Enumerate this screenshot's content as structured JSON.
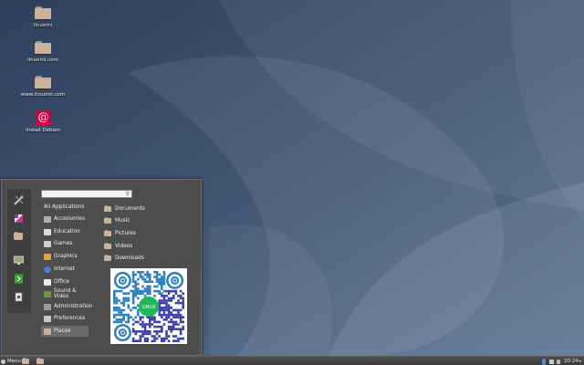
{
  "desktop": {
    "icons": [
      {
        "label": "linuxmi",
        "icon": "folder-icon"
      },
      {
        "label": "linuxmi.com",
        "icon": "folder-icon"
      },
      {
        "label": "www.linuxmi.com",
        "icon": "folder-icon"
      },
      {
        "label": "Install Debian",
        "icon": "debian-installer-icon"
      }
    ]
  },
  "menu": {
    "search": {
      "value": "",
      "placeholder": ""
    },
    "favorites": [
      {
        "icon": "system-tools-icon"
      },
      {
        "icon": "image-editor-icon"
      },
      {
        "icon": "files-icon"
      },
      {
        "icon": "display-settings-icon"
      },
      {
        "icon": "logout-icon"
      },
      {
        "icon": "lock-icon"
      }
    ],
    "categories": [
      {
        "label": "All Applications",
        "icon": ""
      },
      {
        "label": "Accessories",
        "icon": "accessories-icon"
      },
      {
        "label": "Education",
        "icon": "education-icon"
      },
      {
        "label": "Games",
        "icon": "games-icon"
      },
      {
        "label": "Graphics",
        "icon": "graphics-icon"
      },
      {
        "label": "Internet",
        "icon": "internet-icon"
      },
      {
        "label": "Office",
        "icon": "office-icon"
      },
      {
        "label": "Sound & Video",
        "icon": "sound-video-icon"
      },
      {
        "label": "Administration",
        "icon": "administration-icon"
      },
      {
        "label": "Preferences",
        "icon": "preferences-icon"
      },
      {
        "label": "Places",
        "icon": "places-icon",
        "selected": true
      }
    ],
    "places": [
      {
        "label": "Documents"
      },
      {
        "label": "Music"
      },
      {
        "label": "Pictures"
      },
      {
        "label": "Videos"
      },
      {
        "label": "Downloads"
      }
    ],
    "qr_center_label": "LINUX"
  },
  "panel": {
    "menu_label": "Menu",
    "clock": "20:24"
  },
  "colors": {
    "wallpaper": "#3d4f6e",
    "menu_bg": "#4d4d4d",
    "selected": "#6a6a6a",
    "folder": "#c8b39a",
    "debian": "#d5003d",
    "qr_green": "#1db954"
  }
}
